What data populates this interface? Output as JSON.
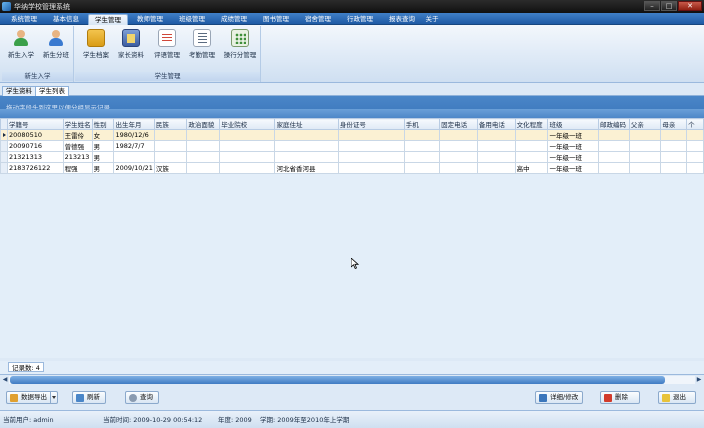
{
  "window": {
    "title": "华纳学校管理系统"
  },
  "menu": {
    "tabs": [
      "系统管理",
      "基本信息",
      "学生管理",
      "教师管理",
      "班级管理",
      "成绩管理",
      "图书管理",
      "宿舍管理",
      "行政管理",
      "报表查询",
      "关于"
    ],
    "active_index": 2
  },
  "ribbon": {
    "group1": {
      "label": "新生入学",
      "buttons": [
        "新生入学",
        "新生分班"
      ]
    },
    "group2": {
      "label": "学生管理",
      "buttons": [
        "学生档案",
        "家长资料",
        "评语管理",
        "考勤管理",
        "操行分管理"
      ]
    }
  },
  "subtabs": [
    "学生资料",
    "学生列表"
  ],
  "group_panel": {
    "hint": "拖动字段头到这里以便分组显示记录"
  },
  "table": {
    "columns": [
      "学籍号",
      "学生姓名",
      "性别",
      "出生年月",
      "民族",
      "政治面貌",
      "毕业院校",
      "家庭住址",
      "身份证号",
      "手机",
      "固定电话",
      "备用电话",
      "文化程度",
      "班级",
      "邮政编码",
      "父亲",
      "母亲",
      "个"
    ],
    "rows": [
      [
        "20080510",
        "王雷伶",
        "女",
        "1980/12/6",
        "",
        "",
        "",
        "",
        "",
        "",
        "",
        "",
        "",
        "一年级一班",
        "",
        "",
        "",
        ""
      ],
      [
        "20090716",
        "曾德强",
        "男",
        "1982/7/7",
        "",
        "",
        "",
        "",
        "",
        "",
        "",
        "",
        "",
        "一年级一班",
        "",
        "",
        "",
        ""
      ],
      [
        "21321313",
        "213213",
        "男",
        "",
        "",
        "",
        "",
        "",
        "",
        "",
        "",
        "",
        "",
        "一年级一班",
        "",
        "",
        "",
        ""
      ],
      [
        "2183726122",
        "程强",
        "男",
        "2009/10/21",
        "汉族",
        "",
        "",
        "河北省香河县",
        "",
        "",
        "",
        "",
        "高中",
        "一年级一班",
        "",
        "",
        "",
        ""
      ]
    ],
    "selected_row": 0
  },
  "record_count": "记录数: 4",
  "toolbar": {
    "export_label": "数据导出",
    "refresh_label": "刷新",
    "query_label": "查询",
    "detail_label": "详细/修改",
    "delete_label": "删除",
    "exit_label": "退出"
  },
  "status": {
    "user": "当前用户: admin",
    "time": "当前时间: 2009-10-29 00:54:12",
    "year": "年度: 2009",
    "term": "学期: 2009年至2010年上学期"
  },
  "colors": {
    "menubar": "#2d6cb5",
    "selected_row": "#fbf1d3",
    "group_panel": "#4a86c8"
  }
}
